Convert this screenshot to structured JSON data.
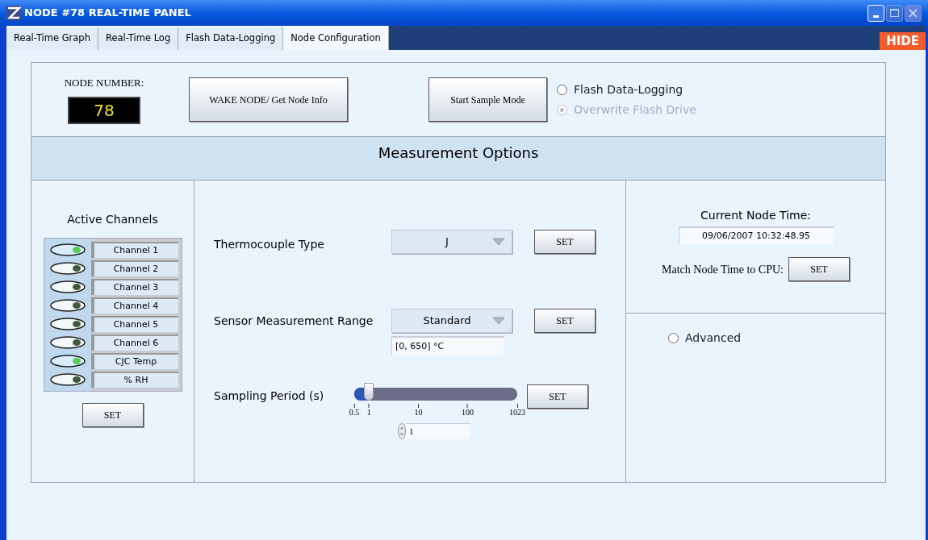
{
  "window": {
    "title": "NODE #78 REAL-TIME PANEL"
  },
  "tabs": [
    {
      "label": "Real-Time Graph",
      "selected": false
    },
    {
      "label": "Real-Time Log",
      "selected": false
    },
    {
      "label": "Flash Data-Logging",
      "selected": false
    },
    {
      "label": "Node Configuration",
      "selected": true
    }
  ],
  "hide_button": "HIDE",
  "node_number": {
    "label": "NODE NUMBER:",
    "value": "78"
  },
  "wake_button": "WAKE NODE/ Get Node Info",
  "sample_button": "Start Sample Mode",
  "mode_options": [
    {
      "label": "Flash Data-Logging",
      "selected": false,
      "disabled": false
    },
    {
      "label": "Overwrite Flash Drive",
      "selected": true,
      "disabled": true
    }
  ],
  "section_title": "Measurement Options",
  "active_channels": {
    "title": "Active Channels",
    "set_button": "SET",
    "channels": [
      {
        "name": "Channel 1",
        "on": true
      },
      {
        "name": "Channel 2",
        "on": false
      },
      {
        "name": "Channel 3",
        "on": false
      },
      {
        "name": "Channel 4",
        "on": false
      },
      {
        "name": "Channel 5",
        "on": false
      },
      {
        "name": "Channel 6",
        "on": false
      },
      {
        "name": "CJC Temp",
        "on": true
      },
      {
        "name": "% RH",
        "on": false
      }
    ]
  },
  "thermocouple": {
    "label": "Thermocouple Type",
    "value": "J",
    "set_button": "SET"
  },
  "range": {
    "label": "Sensor Measurement Range",
    "value": "Standard",
    "reading": "[0, 650] °C",
    "set_button": "SET"
  },
  "sampling": {
    "label": "Sampling Period (s)",
    "level": 0.09,
    "ticks": [
      "0.5",
      "1",
      "10",
      "100",
      "1023"
    ],
    "value": "1",
    "set_button": "SET"
  },
  "node_time": {
    "label": "Current Node Time:",
    "value": "09/06/2007 10:32:48.95",
    "match_label": "Match Node Time to CPU:",
    "set_button": "SET"
  },
  "advanced": {
    "label": "Advanced",
    "selected": false
  }
}
